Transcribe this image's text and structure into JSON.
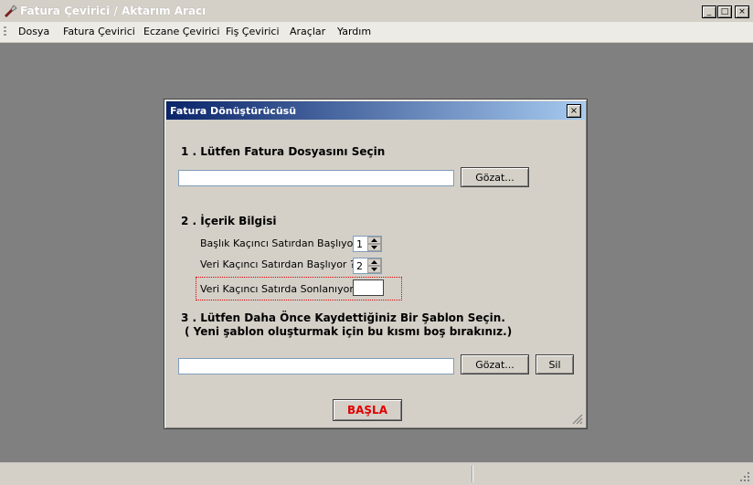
{
  "app": {
    "title": "Fatura Çevirici / Aktarım Aracı"
  },
  "window_buttons": {
    "minimize": "_",
    "maximize": "□",
    "close": "×"
  },
  "menu": [
    "Dosya",
    "Fatura Çevirici",
    "Eczane Çevirici",
    "Fiş Çevirici",
    "Araçlar",
    "Yardım"
  ],
  "dialog": {
    "title": "Fatura Dönüştürücüsü",
    "close_glyph": "×",
    "section1": {
      "title": "1 . Lütfen Fatura Dosyasını Seçin",
      "file_value": "",
      "browse_label": "Gözat..."
    },
    "section2": {
      "title": "2 . İçerik Bilgisi",
      "header_row_label": "Başlık Kaçıncı Satırdan Başlıyor ?",
      "header_row_value": "1",
      "data_row_label": "Veri Kaçıncı Satırdan Başlıyor ?",
      "data_row_value": "2",
      "end_row_label": "Veri Kaçıncı Satırda Sonlanıyor ?",
      "end_row_value": ""
    },
    "section3": {
      "title": "3 . Lütfen Daha Önce Kaydettiğiniz Bir Şablon Seçin.",
      "subtitle": "( Yeni  şablon oluşturmak için bu kısmı boş bırakınız.)",
      "template_value": "",
      "browse_label": "Gözat...",
      "delete_label": "Sil"
    },
    "start_label": "BAŞLA"
  },
  "colors": {
    "workspace": "#808080",
    "title_gradient_start": "#0a246a",
    "title_gradient_end": "#a6caf0",
    "start_text": "#e00000",
    "focus_border": "#e00000"
  },
  "icons": [
    "app-icon",
    "minimize-icon",
    "maximize-icon",
    "close-icon",
    "spin-up-icon",
    "spin-down-icon",
    "size-grip-icon"
  ]
}
